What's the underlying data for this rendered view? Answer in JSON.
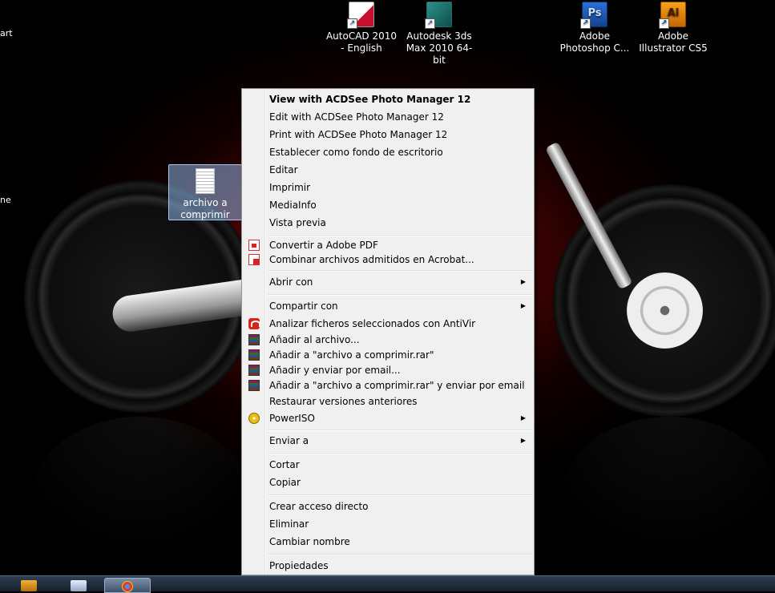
{
  "desktop": {
    "edge_labels": [
      "art",
      "ne"
    ],
    "icons": [
      {
        "label": "AutoCAD 2010 - English",
        "kind": "autocad-icon",
        "glyph": ""
      },
      {
        "label": "Autodesk 3ds Max 2010 64-bit",
        "kind": "3ds-max-icon",
        "glyph": ""
      },
      {
        "label": "Adobe Photoshop C...",
        "kind": "photoshop-icon",
        "glyph": "Ps"
      },
      {
        "label": "Adobe Illustrator CS5",
        "kind": "illustrator-icon",
        "glyph": "Ai"
      }
    ],
    "selected_file": {
      "label": "archivo a comprimir"
    }
  },
  "context_menu": {
    "items": [
      {
        "label": "View with ACDSee Photo Manager 12",
        "bold": true
      },
      {
        "label": "Edit with ACDSee Photo Manager 12"
      },
      {
        "label": "Print with ACDSee Photo Manager 12"
      },
      {
        "label": "Establecer como fondo de escritorio"
      },
      {
        "label": "Editar"
      },
      {
        "label": "Imprimir"
      },
      {
        "label": "MediaInfo"
      },
      {
        "label": "Vista previa"
      },
      {
        "label": "Convertir a Adobe PDF",
        "icon": "pdf-icon"
      },
      {
        "label": "Combinar archivos admitidos en Acrobat...",
        "icon": "pdf-combine-icon"
      },
      {
        "label": "Abrir con",
        "submenu": true
      },
      {
        "label": "Compartir con",
        "submenu": true
      },
      {
        "label": "Analizar ficheros seleccionados con AntiVir",
        "icon": "antivir-icon"
      },
      {
        "label": "Añadir al archivo...",
        "icon": "winrar-icon"
      },
      {
        "label": "Añadir a \"archivo a comprimir.rar\"",
        "icon": "winrar-icon"
      },
      {
        "label": "Añadir y enviar por email...",
        "icon": "winrar-icon"
      },
      {
        "label": "Añadir a \"archivo a comprimir.rar\" y enviar por email",
        "icon": "winrar-icon"
      },
      {
        "label": "Restaurar versiones anteriores"
      },
      {
        "label": "PowerISO",
        "icon": "poweriso-icon",
        "submenu": true
      },
      {
        "label": "Enviar a",
        "submenu": true
      },
      {
        "label": "Cortar"
      },
      {
        "label": "Copiar"
      },
      {
        "label": "Crear acceso directo"
      },
      {
        "label": "Eliminar"
      },
      {
        "label": "Cambiar nombre"
      },
      {
        "label": "Propiedades"
      }
    ],
    "submenu_arrow": "▶"
  },
  "taskbar": {
    "buttons": [
      "app-button-1",
      "app-button-2",
      "chrome-button"
    ]
  },
  "colors": {
    "menu_bg": "#f0f0f0",
    "menu_border": "#979797",
    "taskbar": "#17202c",
    "wallpaper_red": "#8a0a0a"
  }
}
